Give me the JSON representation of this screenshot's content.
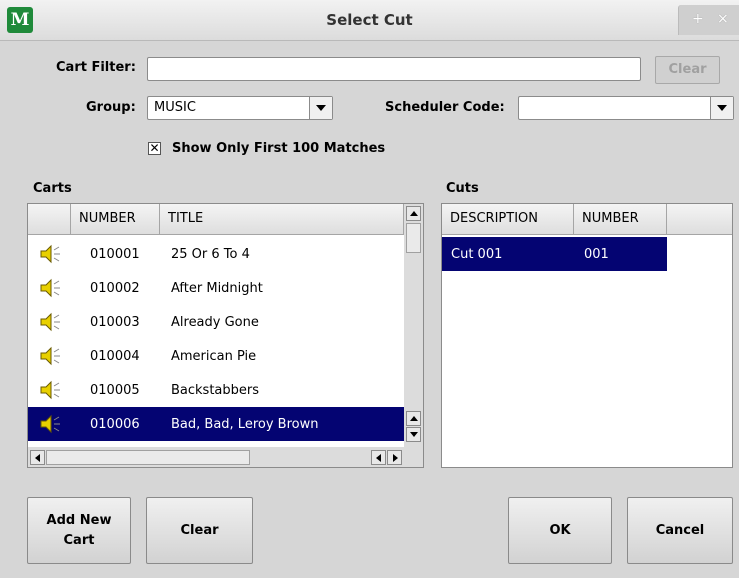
{
  "window": {
    "title": "Select Cut",
    "logo_letter": "M",
    "buttons": [
      "+",
      "×"
    ]
  },
  "filter": {
    "label": "Cart Filter:",
    "value": "",
    "clear_label": "Clear"
  },
  "group": {
    "label": "Group:",
    "value": "MUSIC"
  },
  "scheduler": {
    "label": "Scheduler Code:",
    "value": ""
  },
  "show_first": {
    "checked": true,
    "check_mark": "✕",
    "label": "Show Only First 100 Matches"
  },
  "carts": {
    "label": "Carts",
    "columns": [
      "NUMBER",
      "TITLE"
    ],
    "rows": [
      {
        "number": "010001",
        "title": "25 Or 6 To 4",
        "icon": "speaker-icon",
        "selected": false
      },
      {
        "number": "010002",
        "title": "After Midnight",
        "icon": "speaker-icon",
        "selected": false
      },
      {
        "number": "010003",
        "title": "Already Gone",
        "icon": "speaker-icon",
        "selected": false
      },
      {
        "number": "010004",
        "title": "American Pie",
        "icon": "speaker-icon",
        "selected": false
      },
      {
        "number": "010005",
        "title": "Backstabbers",
        "icon": "speaker-icon",
        "selected": false
      },
      {
        "number": "010006",
        "title": "Bad, Bad, Leroy Brown",
        "icon": "speaker-icon",
        "selected": true
      }
    ]
  },
  "cuts": {
    "label": "Cuts",
    "columns": [
      "DESCRIPTION",
      "NUMBER"
    ],
    "rows": [
      {
        "description": "Cut 001",
        "number": "001",
        "selected": true
      }
    ]
  },
  "buttons": {
    "add_new_cart_line1": "Add New",
    "add_new_cart_line2": "Cart",
    "clear": "Clear",
    "ok": "OK",
    "cancel": "Cancel"
  },
  "colors": {
    "selection": "#040472",
    "logo": "#1f8a3a",
    "background": "#d6d6d6"
  }
}
